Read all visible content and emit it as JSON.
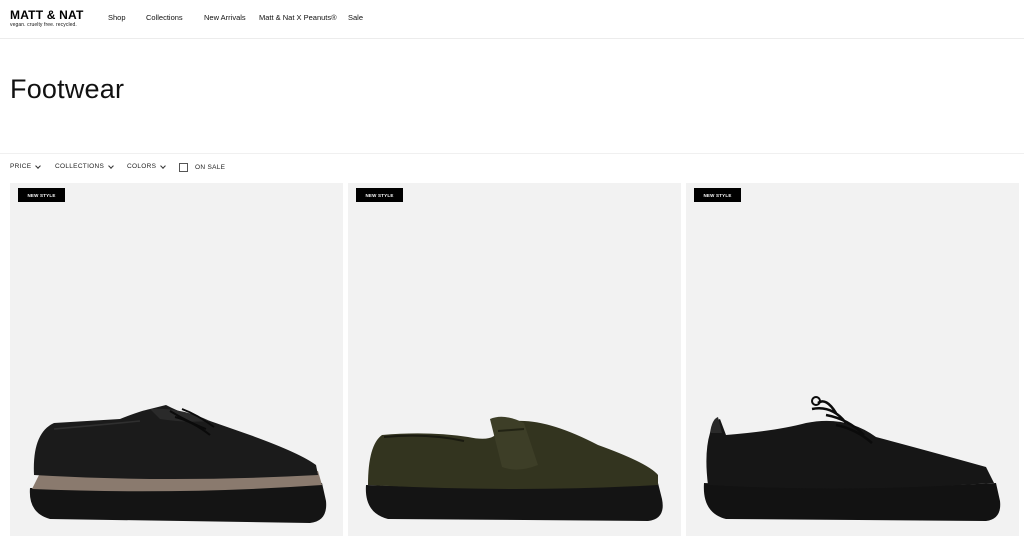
{
  "brand": {
    "name": "MATT & NAT",
    "tagline": "vegan. cruelty free. recycled."
  },
  "nav": {
    "items": [
      {
        "label": "Shop"
      },
      {
        "label": "Collections"
      },
      {
        "label": "New Arrivals"
      },
      {
        "label": "Matt & Nat X Peanuts®"
      },
      {
        "label": "Sale"
      }
    ]
  },
  "page": {
    "title": "Footwear"
  },
  "filters": {
    "price": "PRICE",
    "collections": "COLLECTIONS",
    "colors": "COLORS",
    "on_sale": "ON SALE",
    "on_sale_checked": false
  },
  "products": [
    {
      "badge": "NEW STYLE",
      "icon": "black-lace-up-shoe-with-brown-sole-stripe",
      "colors": {
        "upper": "#1b1b1b",
        "sole": "#141414",
        "stripe": "#8a7a6e"
      }
    },
    {
      "badge": "NEW STYLE",
      "icon": "dark-olive-loafer",
      "colors": {
        "upper": "#33341f",
        "sole": "#141414"
      }
    },
    {
      "badge": "NEW STYLE",
      "icon": "black-derby-lace-up-shoe",
      "colors": {
        "upper": "#161616",
        "sole": "#121212"
      }
    }
  ],
  "colors": {
    "background": "#ffffff",
    "card_background": "#f2f2f2",
    "badge_background": "#000000",
    "badge_text": "#ffffff"
  }
}
